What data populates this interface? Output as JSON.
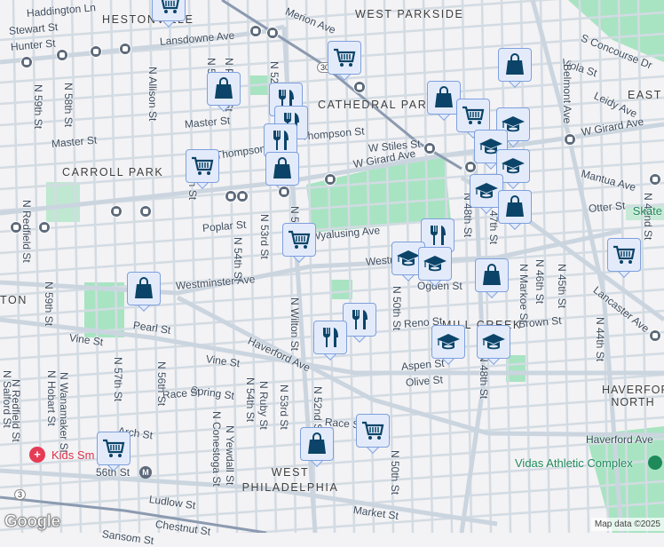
{
  "map": {
    "attribution": "Map data ©2025",
    "logo": "Google",
    "colors": {
      "park": "#a8e4c2",
      "road": "#d3dbe3",
      "highway": "#8b9ab0",
      "marker_bg": "#e3ebfb",
      "icon": "#0b4468",
      "background": "#f3f2f4"
    },
    "route_shields": [
      "30",
      "3"
    ],
    "neighborhoods": [
      "HESTONVILLE",
      "WEST PARKSIDE",
      "CATHEDRAL PARK",
      "EAST",
      "CARROLL PARK",
      "MILL CREEK",
      "HAVERFORD NORTH",
      "WEST PHILADELPHIA",
      "TON"
    ],
    "streets": [
      "Haddington Ln",
      "Stewart St",
      "Hunter St",
      "Lansdowne Ave",
      "Merion Ave",
      "Master St",
      "Master St",
      "Thompson St",
      "W Thompson St",
      "W Stiles St",
      "W Girard Ave",
      "W Girard Ave",
      "Poplar St",
      "Wyalusing Ave",
      "Westminster Ave",
      "Westminster Ave",
      "Pearl St",
      "Vine St",
      "Vine St",
      "Haverford Ave",
      "Spring St",
      "Race St",
      "Race St",
      "Arch St",
      "56th St",
      "Ludlow St",
      "Chestnut St",
      "Market St",
      "Sansom St",
      "Reno St",
      "Brown St",
      "Olive St",
      "Aspen St",
      "Viola St",
      "Leidy Ave",
      "Mantua Ave",
      "Otter St",
      "Lancaster Ave",
      "Haverford Ave",
      "S Concourse Dr",
      "Ogden St"
    ],
    "vertical_streets": [
      "N 59th St",
      "N 58th St",
      "N Allison St",
      "N 54th St",
      "N Peach St",
      "N 52nd St",
      "N 55th St",
      "N 53rd St",
      "N 54th St",
      "N 52nd St",
      "N Redfield St",
      "N Wilton St",
      "N 52nd St",
      "N 53rd St",
      "N Ruby St",
      "N 54th St",
      "N Conestoga St",
      "N Yewdall St",
      "N 56th St",
      "N 57th St",
      "N Hobart St",
      "N Wanamaker St",
      "N Redfield St",
      "N Salford St",
      "N 59th St",
      "N 48th St",
      "N 47th St",
      "N 50th St",
      "N 48th St",
      "N Markoe St",
      "N 46th St",
      "N 45th St",
      "N 44th St",
      "N 42nd St",
      "N 50th St",
      "Belmont Ave"
    ],
    "pois": {
      "skate": "Skate",
      "vidas": "Vidas Athletic Complex",
      "kids": "Kids Sm",
      "metro": "M"
    },
    "markers": [
      "cart",
      "cart",
      "bag",
      "cart",
      "food",
      "food",
      "food",
      "bag",
      "cart",
      "bag",
      "bag",
      "cart",
      "school",
      "school",
      "school",
      "school",
      "bag",
      "food",
      "school",
      "school",
      "bag",
      "cart",
      "bag",
      "food",
      "food",
      "school",
      "school",
      "cart",
      "bag",
      "cart"
    ]
  }
}
